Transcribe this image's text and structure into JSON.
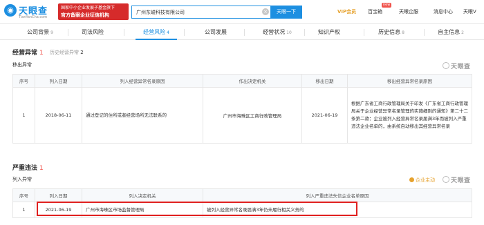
{
  "header": {
    "logo_text": "天眼查",
    "logo_url": "TianYanCha.com",
    "banner_line1": "国家中小企业发展子基金旗下",
    "banner_line2": "官方备案企业征信机构",
    "search_value": "广州东峻科技有限公司",
    "search_button": "天眼一下",
    "nav": [
      {
        "label": "VIP会员",
        "name": "vip"
      },
      {
        "label": "百宝箱",
        "name": "toolbox"
      },
      {
        "label": "天眼企服",
        "name": "enterprise-service"
      },
      {
        "label": "消息中心",
        "name": "messages"
      },
      {
        "label": "天眼V",
        "name": "user"
      }
    ],
    "new_badge": "new"
  },
  "tabs": [
    {
      "label": "公司背景",
      "count": "9",
      "active": false
    },
    {
      "label": "司法风险",
      "count": "",
      "active": false
    },
    {
      "label": "经营风险",
      "count": "4",
      "active": true
    },
    {
      "label": "公司发展",
      "count": "",
      "active": false
    },
    {
      "label": "经营状况",
      "count": "10",
      "active": false
    },
    {
      "label": "知识产权",
      "count": "",
      "active": false
    },
    {
      "label": "历史信息",
      "count": "8",
      "active": false
    },
    {
      "label": "自主信息",
      "count": "2",
      "active": false
    }
  ],
  "abnormal": {
    "title": "经营异常",
    "count": "1",
    "history_label": "历史经营异常",
    "history_count": "2",
    "subtitle": "移出异常",
    "watermark": "天眼查",
    "columns": [
      "序号",
      "列入日期",
      "列入经营异常名录原因",
      "作出决定机关",
      "移出日期",
      "移出经营异常名录原因"
    ],
    "rows": [
      {
        "no": "1",
        "date_in": "2018-06-11",
        "reason_in": "通过登记的住所或者经营场所无法联系的",
        "authority": "广州市海珠区工商行政管理局",
        "date_out": "2021-06-19",
        "reason_out": "根据广东省工商行政管理局关于印发《广东省工商行政管理局关于企业经营异常名录管理的实施细则的通知》第二十二条第二款：企业被列入经营异常名录届满3年而被列入严重违法企业名单的，由系统自动移出其经营异常名录"
      }
    ]
  },
  "serious": {
    "title": "严重违法",
    "count": "1",
    "subtitle": "列入异常",
    "lead_button": "企业主动",
    "watermark": "天眼查",
    "columns": [
      "序号",
      "列入日期",
      "列入决定机关",
      "列入严重违法失信企业名单原因"
    ],
    "rows": [
      {
        "no": "1",
        "date_in": "2021-06-19",
        "authority": "广州市海珠区市场监督管理局",
        "reason": "被列入经营异常名录届满3年仍未履行相关义务的"
      }
    ]
  }
}
